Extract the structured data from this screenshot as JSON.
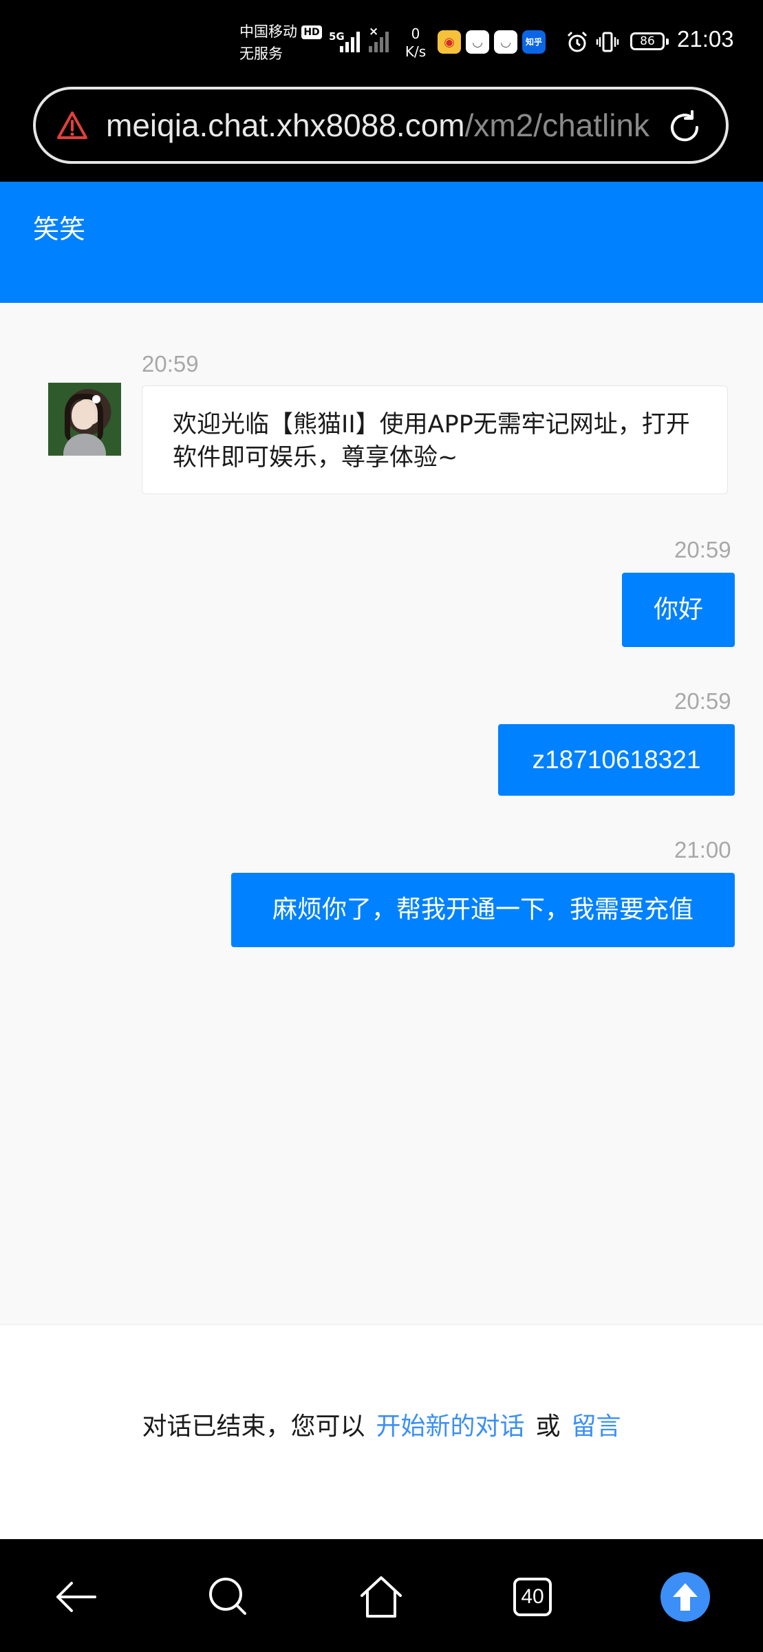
{
  "status_bar": {
    "carrier_line1": "中国移动",
    "carrier_line2": "无服务",
    "hd": "HD",
    "network": "5G",
    "net_speed_value": "0",
    "net_speed_unit": "K/s",
    "zhihu_label": "知乎",
    "battery": "86",
    "time": "21:03"
  },
  "url_bar": {
    "host": "meiqia.chat.xhx8088.com",
    "path": "/xm2/chatlink"
  },
  "chat": {
    "agent_name": "笑笑",
    "messages": [
      {
        "time": "20:59",
        "text": "欢迎光临【熊猫II】使用APP无需牢记网址，打开软件即可娱乐，尊享体验~"
      },
      {
        "time": "20:59",
        "text": "你好"
      },
      {
        "time": "20:59",
        "text": "z18710618321"
      },
      {
        "time": "21:00",
        "text": "麻烦你了，帮我开通一下，我需要充值"
      }
    ]
  },
  "footer": {
    "ended_text": "对话已结束，您可以",
    "new_chat_link": "开始新的对话",
    "or_text": "或",
    "leave_message_link": "留言"
  },
  "nav_bar": {
    "tab_count": "40"
  },
  "colors": {
    "accent": "#0081ff",
    "link": "#3b8ff6",
    "warning": "#e0403a"
  },
  "icons": [
    "warning-icon",
    "reload-icon",
    "back-icon",
    "search-icon",
    "home-icon",
    "tabs-icon",
    "scroll-up-icon",
    "alarm-icon",
    "vibrate-icon",
    "weibo-icon"
  ]
}
